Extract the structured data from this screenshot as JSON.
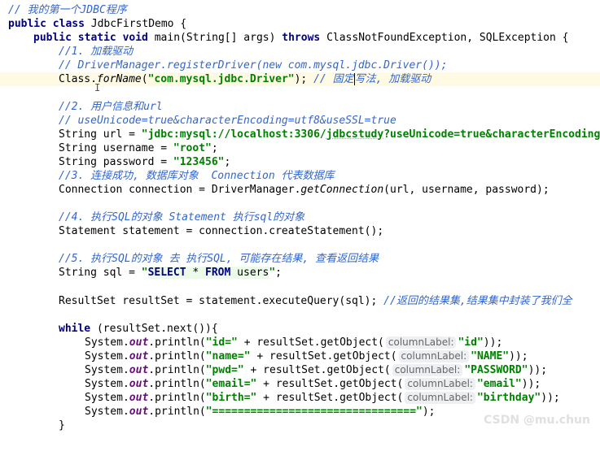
{
  "lines": {
    "l1": "// 我的第一个JDBC程序",
    "l2a": "public class ",
    "l2b": "JdbcFirstDemo {",
    "l3a": "public static void ",
    "l3b": "main(String[] args) ",
    "l3c": "throws ",
    "l3d": "ClassNotFoundException, SQLException {",
    "l4": "//1. 加载驱动",
    "l5": "// DriverManager.registerDriver(new com.mysql.jdbc.Driver());",
    "l6a": "Class.",
    "l6b": "forName",
    "l6c": "(",
    "l6d": "\"com.mysql.jdbc.Driver\"",
    "l6e": "); ",
    "l6f": "// 固定",
    "l6g": "写法, 加载驱动",
    "l8": "//2. 用户信息和url",
    "l9": "// useUnicode=true&characterEncoding=utf8&useSSL=true",
    "l10a": "String url = ",
    "l10b": "\"jdbc:mysql://localhost:3306/",
    "l10c": "jdbcstudy",
    "l10d": "?useUnicode=true&characterEncoding",
    "l11a": "String username = ",
    "l11b": "\"root\"",
    "l11c": ";",
    "l12a": "String password = ",
    "l12b": "\"123456\"",
    "l12c": ";",
    "l13": "//3. 连接成功, 数据库对象  Connection 代表数据库",
    "l14a": "Connection connection = DriverManager.",
    "l14b": "getConnection",
    "l14c": "(url, username, password);",
    "l16": "//4. 执行SQL的对象 Statement 执行sql的对象",
    "l17": "Statement statement = connection.createStatement();",
    "l19": "//5. 执行SQL的对象 去 执行SQL, 可能存在结果, 查看返回结果",
    "l20a": "String sql = ",
    "l20b": "\"",
    "l20c": "SELECT",
    "l20d": " * ",
    "l20e": "FROM",
    "l20f": " users",
    "l20g": "\"",
    "l20h": ";",
    "l22a": "ResultSet resultSet = statement.executeQuery(sql); ",
    "l22b": "//返回的结果集,结果集中封装了我们全",
    "l24a": "while ",
    "l24b": "(resultSet.next()){",
    "println": "System.",
    "out": "out",
    "println2": ".println(",
    "r1a": "\"id=\"",
    "r1b": " + resultSet.getObject(",
    "r1c": "\"id\"",
    "r1d": "));",
    "r2a": "\"name=\"",
    "r2b": " + resultSet.getObject(",
    "r2c": "\"NAME\"",
    "r2d": "));",
    "r3a": "\"pwd=\"",
    "r3b": " + resultSet.getObject(",
    "r3c": "\"PASSWORD\"",
    "r3d": "));",
    "r4a": "\"email=\"",
    "r4b": " + resultSet.getObject(",
    "r4c": "\"email\"",
    "r4d": "));",
    "r5a": "\"birth=\"",
    "r5b": " + resultSet.getObject(",
    "r5c": "\"birthday\"",
    "r5d": "));",
    "r6a": "\"================================\"",
    "r6b": ");",
    "close": "}",
    "hint": "columnLabel:"
  },
  "watermark": "CSDN @mu.chun",
  "colors": {
    "keyword": "#000080",
    "string": "#008000",
    "comment": "#3366cc",
    "field": "#660e7a",
    "current_line": "#fffae3",
    "inlay_hint_bg": "#edeff2"
  }
}
